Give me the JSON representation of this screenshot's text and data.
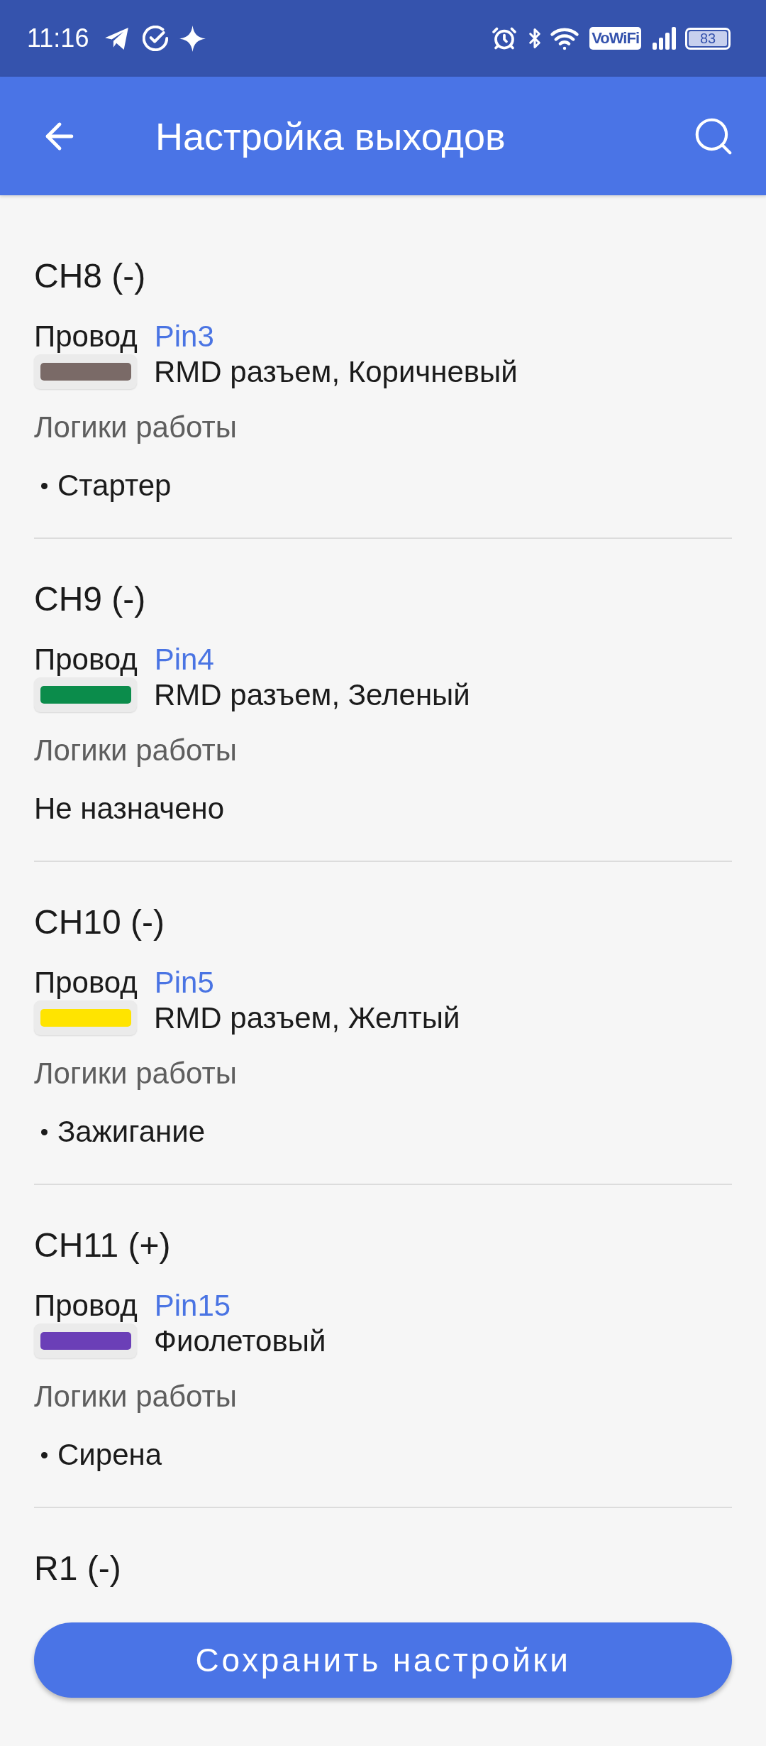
{
  "status_bar": {
    "time": "11:16",
    "network_badge": "VoWiFi",
    "battery": "83"
  },
  "app_bar": {
    "title": "Настройка выходов"
  },
  "outputs": [
    {
      "title": "CH8 (-)",
      "wire_label": "Провод",
      "pin": "Pin3",
      "color": "#7a6a67",
      "wire_description": "RMD разъем, Коричневый",
      "logic_label": "Логики работы",
      "logic_items": [
        {
          "kind": "bullet",
          "text": "Стартер"
        }
      ]
    },
    {
      "title": "CH9 (-)",
      "wire_label": "Провод",
      "pin": "Pin4",
      "color": "#0b8c4b",
      "wire_description": "RMD разъем, Зеленый",
      "logic_label": "Логики работы",
      "logic_items": [
        {
          "kind": "plain",
          "text": "Не назначено"
        }
      ]
    },
    {
      "title": "CH10 (-)",
      "wire_label": "Провод",
      "pin": "Pin5",
      "color": "#ffe400",
      "wire_description": "RMD разъем, Желтый",
      "logic_label": "Логики работы",
      "logic_items": [
        {
          "kind": "bullet",
          "text": "Зажигание"
        }
      ]
    },
    {
      "title": "CH11 (+)",
      "wire_label": "Провод",
      "pin": "Pin15",
      "color": "#6b3fb7",
      "wire_description": "Фиолетовый",
      "logic_label": "Логики работы",
      "logic_items": [
        {
          "kind": "bullet",
          "text": "Сирена"
        }
      ]
    },
    {
      "title": "R1 (-)"
    }
  ],
  "save_button": {
    "label": "Сохранить настройки"
  }
}
